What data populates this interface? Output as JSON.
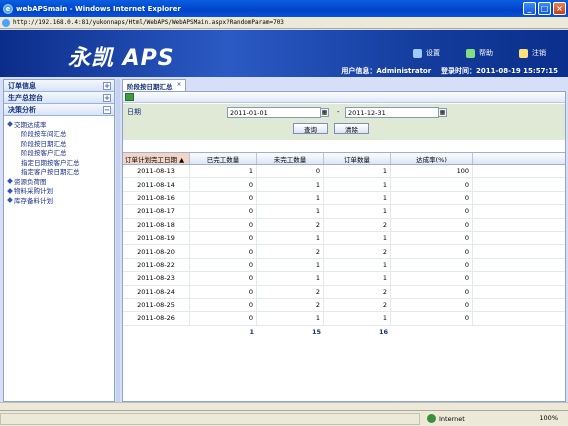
{
  "window": {
    "title": "webAPSmain - Windows Internet Explorer",
    "url": "http://192.168.0.4:81/yukonnaps/Html/WebAPS/WebAPSMain.aspx?RandomParam=703"
  },
  "header": {
    "logo": "永凯 APS",
    "nav": {
      "settings": "设置",
      "help": "帮助",
      "logout": "注销"
    },
    "user_info": "用户信息：Administrator",
    "login_time": "登录时间：2011-08-19 15:57:15"
  },
  "sidebar": {
    "sections": [
      "订单信息",
      "生产总控台",
      "决策分析"
    ],
    "items": [
      {
        "label": "交期达成率",
        "level": 1
      },
      {
        "label": "阶段按车间汇总",
        "level": 2
      },
      {
        "label": "阶段按日期汇总",
        "level": 2
      },
      {
        "label": "阶段按客户汇总",
        "level": 2
      },
      {
        "label": "指定日期按客户汇总",
        "level": 2
      },
      {
        "label": "指定客户按日期汇总",
        "level": 2
      },
      {
        "label": "资源负荷图",
        "level": 1
      },
      {
        "label": "物料采购计划",
        "level": 1
      },
      {
        "label": "库存备料计划",
        "level": 1
      }
    ]
  },
  "tab": {
    "label": "阶段按日期汇总"
  },
  "filter": {
    "date_label": "日期",
    "start": "2011-01-01",
    "end": "2011-12-31",
    "dash": "-",
    "query_btn": "查询",
    "clear_btn": "清除"
  },
  "grid": {
    "headers": [
      "订单计划完工日期 ▲",
      "已完工数量",
      "未完工数量",
      "订单数量",
      "达成率(%)"
    ],
    "rows": [
      [
        "2011-08-13",
        "1",
        "0",
        "1",
        "100"
      ],
      [
        "2011-08-14",
        "0",
        "1",
        "1",
        "0"
      ],
      [
        "2011-08-16",
        "0",
        "1",
        "1",
        "0"
      ],
      [
        "2011-08-17",
        "0",
        "1",
        "1",
        "0"
      ],
      [
        "2011-08-18",
        "0",
        "2",
        "2",
        "0"
      ],
      [
        "2011-08-19",
        "0",
        "1",
        "1",
        "0"
      ],
      [
        "2011-08-20",
        "0",
        "2",
        "2",
        "0"
      ],
      [
        "2011-08-22",
        "0",
        "1",
        "1",
        "0"
      ],
      [
        "2011-08-23",
        "0",
        "1",
        "1",
        "0"
      ],
      [
        "2011-08-24",
        "0",
        "2",
        "2",
        "0"
      ],
      [
        "2011-08-25",
        "0",
        "2",
        "2",
        "0"
      ],
      [
        "2011-08-26",
        "0",
        "1",
        "1",
        "0"
      ]
    ],
    "totals": [
      "",
      "1",
      "15",
      "16",
      ""
    ]
  },
  "status": {
    "zone": "Internet",
    "zoom": "100%"
  }
}
